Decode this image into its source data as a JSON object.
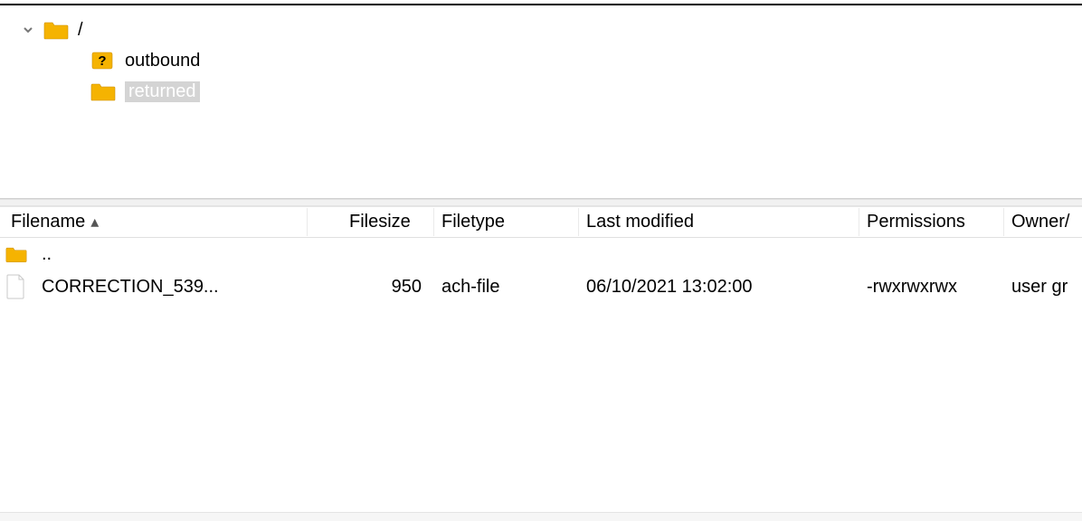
{
  "tree": {
    "root": {
      "label": "/"
    },
    "children": [
      {
        "label": "outbound",
        "selected": false,
        "icon": "unknown"
      },
      {
        "label": "returned",
        "selected": true,
        "icon": "folder"
      }
    ]
  },
  "columns": {
    "filename": "Filename",
    "filesize": "Filesize",
    "filetype": "Filetype",
    "modified": "Last modified",
    "permissions": "Permissions",
    "owner": "Owner/"
  },
  "sort_indicator": "▴",
  "rows": [
    {
      "icon": "folder-up",
      "filename": "..",
      "filesize": "",
      "filetype": "",
      "modified": "",
      "permissions": "",
      "owner": ""
    },
    {
      "icon": "file",
      "filename": "CORRECTION_539...",
      "filesize": "950",
      "filetype": "ach-file",
      "modified": "06/10/2021 13:02:00",
      "permissions": "-rwxrwxrwx",
      "owner": "user gr"
    }
  ]
}
